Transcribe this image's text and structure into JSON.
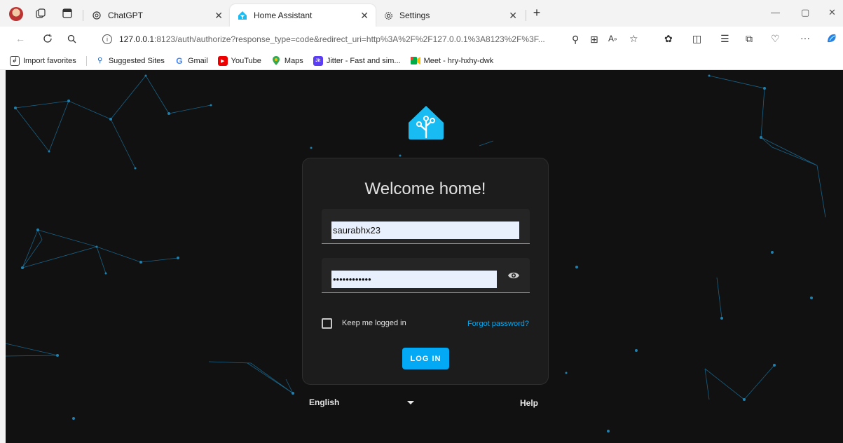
{
  "tabs": [
    {
      "title": "ChatGPT",
      "favicon": "chatgpt-icon"
    },
    {
      "title": "Home Assistant",
      "favicon": "home-assistant-icon",
      "active": true
    },
    {
      "title": "Settings",
      "favicon": "gear-icon"
    }
  ],
  "address": {
    "host": "127.0.0.1",
    "path": ":8123/auth/authorize?response_type=code&redirect_uri=http%3A%2F%2F127.0.0.1%3A8123%2F%3F..."
  },
  "favorites": [
    {
      "label": "Import favorites",
      "icon": "import-icon"
    },
    {
      "label": "Suggested Sites",
      "icon": "search-icon"
    },
    {
      "label": "Gmail",
      "icon": "google-icon"
    },
    {
      "label": "YouTube",
      "icon": "youtube-icon"
    },
    {
      "label": "Maps",
      "icon": "maps-pin-icon"
    },
    {
      "label": "Jitter - Fast and sim...",
      "icon": "jitter-icon"
    },
    {
      "label": "Meet - hry-hxhy-dwk",
      "icon": "meet-icon"
    }
  ],
  "login": {
    "title": "Welcome home!",
    "username": "saurabhx23",
    "password_mask": "••••••••••••",
    "keep_logged_in": "Keep me logged in",
    "forgot_password": "Forgot password?",
    "login_button": "LOG IN"
  },
  "footer": {
    "language": "English",
    "help": "Help"
  },
  "colors": {
    "accent": "#03a9f4",
    "page_bg": "#111111",
    "card_bg": "#1c1c1c",
    "network_lines": "#1b6b93"
  }
}
